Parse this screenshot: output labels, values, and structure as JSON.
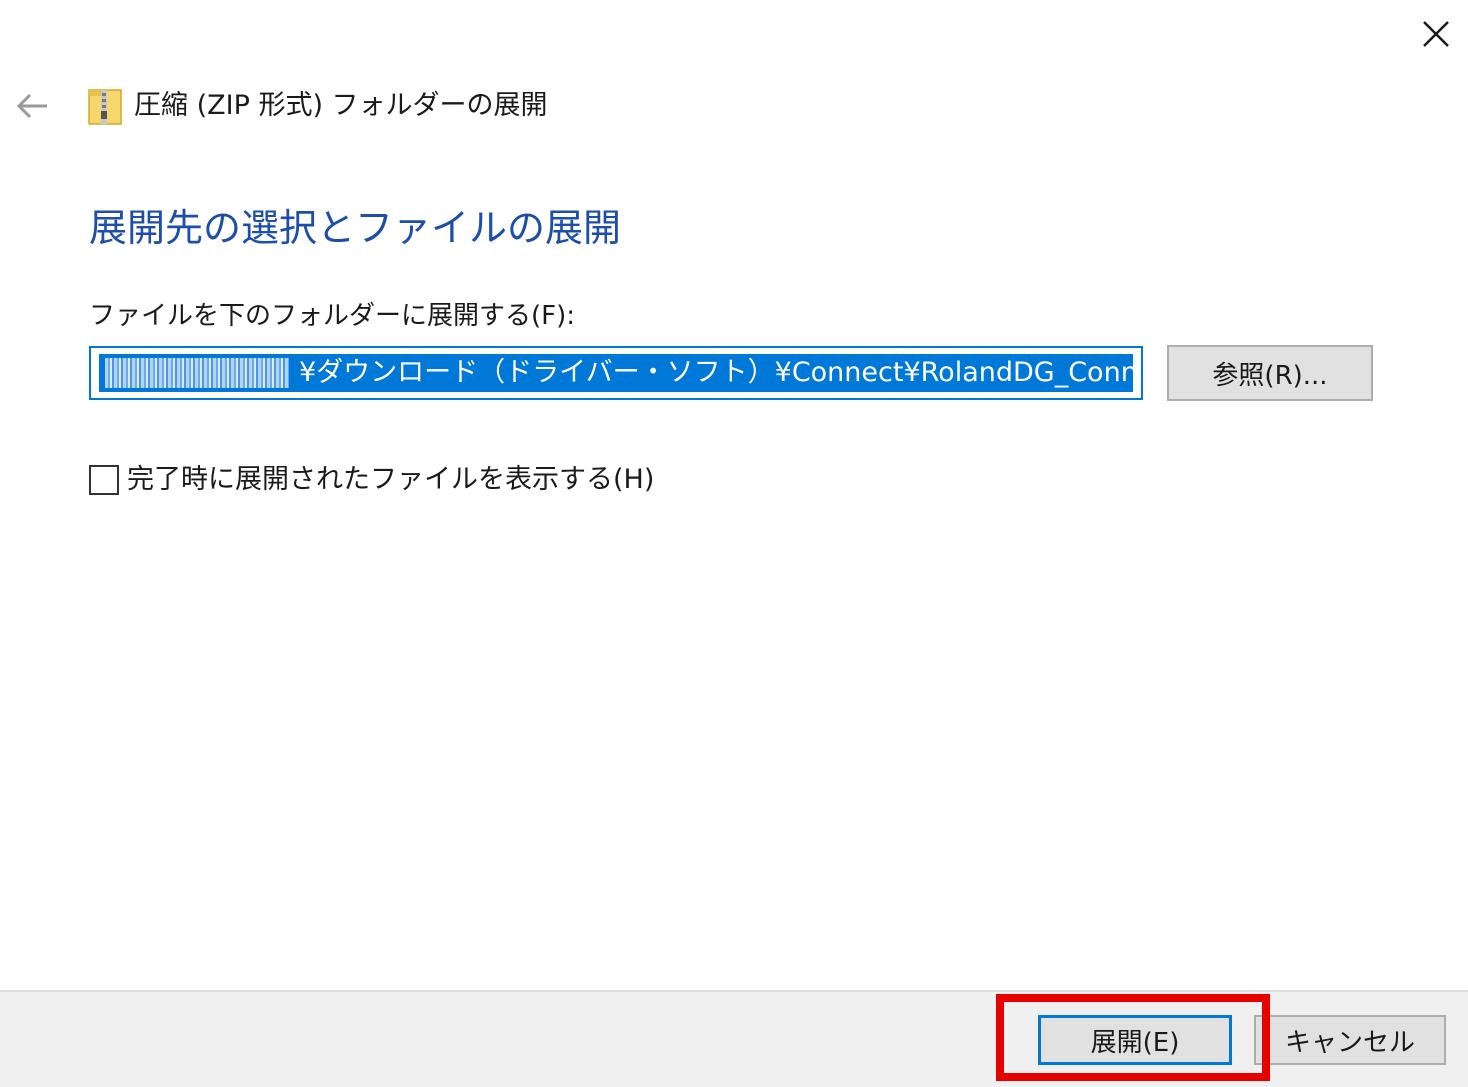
{
  "window": {
    "title": "圧縮 (ZIP 形式) フォルダーの展開"
  },
  "main": {
    "heading": "展開先の選択とファイルの展開",
    "path_label": "ファイルを下のフォルダーに展開する(F):",
    "path_value": "¥ダウンロード（ドライバー・ソフト）¥Connect¥RolandDG_Connect_Setup",
    "browse_label": "参照(R)...",
    "show_files_label": "完了時に展開されたファイルを表示する(H)",
    "show_files_checked": false
  },
  "footer": {
    "extract_label": "展開(E)",
    "cancel_label": "キャンセル"
  },
  "icons": {
    "close": "close-icon",
    "back": "back-arrow-icon",
    "zip_folder": "zip-folder-icon"
  },
  "colors": {
    "accent": "#0078d7",
    "heading": "#1e4fa8",
    "highlight": "#e60000",
    "footer_bg": "#f0f0f0"
  }
}
